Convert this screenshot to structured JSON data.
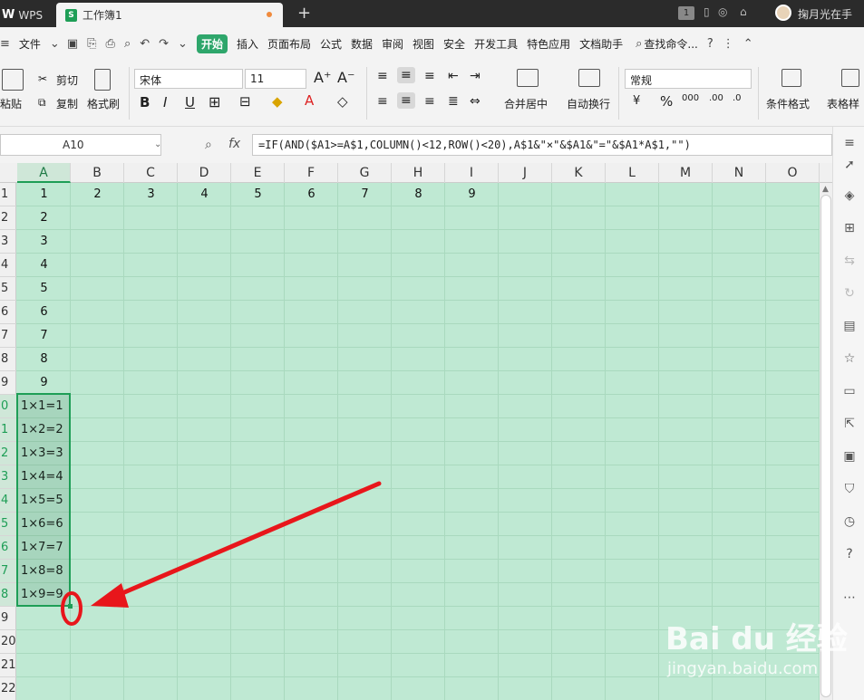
{
  "titlebar": {
    "wps_label": "WPS",
    "doc_tab": "工作簿1",
    "user_name": "掬月光在手",
    "badge": "1"
  },
  "menubar": {
    "file": "文件",
    "tabs": [
      "开始",
      "插入",
      "页面布局",
      "公式",
      "数据",
      "审阅",
      "视图",
      "安全",
      "开发工具",
      "特色应用",
      "文档助手"
    ],
    "active_tab": "开始",
    "search": "查找命令..."
  },
  "ribbon": {
    "paste": "粘贴",
    "cut": "剪切",
    "copy": "复制",
    "format_painter": "格式刷",
    "font_name": "宋体",
    "font_size": "11",
    "merge_center": "合并居中",
    "auto_wrap": "自动换行",
    "number_format": "常规",
    "conditional_format": "条件格式",
    "table_style": "表格样"
  },
  "formula": {
    "name_box": "A10",
    "fx_label": "fx",
    "content": "=IF(AND($A1>=A$1,COLUMN()<12,ROW()<20),A$1&\"×\"&$A1&\"=\"&$A1*A$1,\"\")"
  },
  "sheet": {
    "columns": [
      "A",
      "B",
      "C",
      "D",
      "E",
      "F",
      "G",
      "H",
      "I",
      "J",
      "K",
      "L",
      "M",
      "N",
      "O"
    ],
    "rows": [
      "1",
      "2",
      "3",
      "4",
      "5",
      "6",
      "7",
      "8",
      "9",
      "0",
      "1",
      "2",
      "3",
      "4",
      "5",
      "6",
      "7",
      "8",
      "9",
      "20",
      "21",
      "22"
    ],
    "active_column": "A",
    "row1": [
      "1",
      "2",
      "3",
      "4",
      "5",
      "6",
      "7",
      "8",
      "9"
    ],
    "colA": [
      "2",
      "3",
      "4",
      "5",
      "6",
      "7",
      "8",
      "9"
    ],
    "products": [
      "1×1=1",
      "1×2=2",
      "1×3=3",
      "1×4=4",
      "1×5=5",
      "1×6=6",
      "1×7=7",
      "1×8=8",
      "1×9=9"
    ]
  },
  "watermark": {
    "brand": "Bai du 经验",
    "url": "jingyan.baidu.com"
  },
  "colors": {
    "accent": "#1e9e56",
    "sheet_bg": "#bfe9d3",
    "arrow": "#e8161b"
  }
}
